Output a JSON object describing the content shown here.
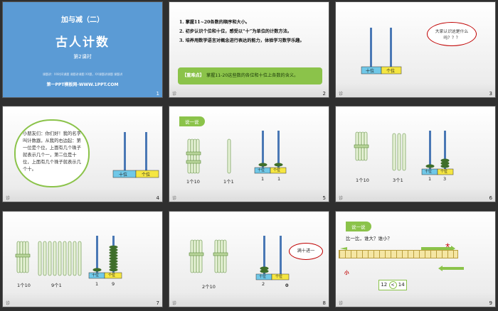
{
  "footer_label": "诊",
  "slides": {
    "s1": {
      "num": "1",
      "top": "加与减（二）",
      "title": "古人计数",
      "sub": "第2课时",
      "note": "课题讲：XX时间课题 课题讲课题 XX题，XX课题讲课题 课题讲",
      "site": "第一PPT模板网-WWW.1PPT.COM"
    },
    "s2": {
      "num": "2",
      "goals": [
        "1. 掌握11~20各数的顺序和大小。",
        "2. 初步认识个位和十位，感受以“十”为单位的计数方法。",
        "3. 培养用数学语言对概念进行表达的能力，体验学习数学乐趣。"
      ],
      "focus_label": "【重难点】",
      "focus_text": "掌握11-20这些数的各位和十位上各数的含义。"
    },
    "s3": {
      "num": "3",
      "tens": "十位",
      "ones": "个位",
      "bubble": "大家认识这是什么吗？？？"
    },
    "s4": {
      "num": "4",
      "text": "小朋友们：你们好！我的名字叫计数器，从我的右边起：第一位是个位，上面有几个珠子就表示几个一，第二位是十位，上面有几个珠子就表示几个十。",
      "tens": "十位",
      "ones": "个位"
    },
    "s5": {
      "num": "5",
      "tag": "说一说",
      "l1": "1个10",
      "l2": "1个1",
      "tens": "十位",
      "ones": "个位",
      "v1": "1",
      "v2": "1"
    },
    "s6": {
      "num": "6",
      "l1": "1个10",
      "l2": "3个1",
      "tens": "十位",
      "ones": "个位",
      "v1": "1",
      "v2": "3"
    },
    "s7": {
      "num": "7",
      "l1": "1个10",
      "l2": "9个1",
      "tens": "十位",
      "ones": "个位",
      "v1": "1",
      "v2": "9"
    },
    "s8": {
      "num": "8",
      "l1": "2个10",
      "tens": "十位",
      "ones": "个位",
      "v1": "2",
      "v2": "0",
      "bubble": "满十进一"
    },
    "s9": {
      "num": "9",
      "tag": "说一说",
      "q": "比一比，谁大？谁小？",
      "big": "大",
      "small": "小",
      "a": "12",
      "op": "<",
      "b": "14"
    }
  },
  "colors": {
    "title_bg": "#5b9bd5",
    "accent_green": "#8bc34a",
    "rod_blue": "#4a78b5",
    "tens_bg": "#70c8e8",
    "ones_bg": "#f5e642",
    "bead": "#3f6e2a",
    "red": "#c00000"
  }
}
